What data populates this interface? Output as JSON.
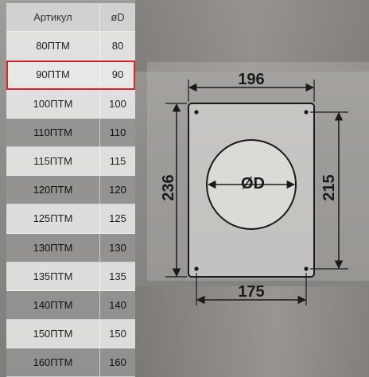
{
  "table": {
    "header": {
      "code": "Артикул",
      "dia": "øD"
    },
    "rows": [
      {
        "code": "80ПТМ",
        "dia": "80"
      },
      {
        "code": "90ПТМ",
        "dia": "90"
      },
      {
        "code": "100ПТМ",
        "dia": "100"
      },
      {
        "code": "110ПТМ",
        "dia": "110"
      },
      {
        "code": "115ПТМ",
        "dia": "115"
      },
      {
        "code": "120ПТМ",
        "dia": "120"
      },
      {
        "code": "125ПТМ",
        "dia": "125"
      },
      {
        "code": "130ПТМ",
        "dia": "130"
      },
      {
        "code": "135ПТМ",
        "dia": "135"
      },
      {
        "code": "140ПТМ",
        "dia": "140"
      },
      {
        "code": "150ПТМ",
        "dia": "150"
      },
      {
        "code": "160ПТМ",
        "dia": "160"
      }
    ],
    "selected_row": 1,
    "colors": {
      "selected_outline": "#d6252c"
    }
  },
  "drawing": {
    "width_top": "196",
    "width_bottom": "175",
    "height_left": "236",
    "height_right": "215",
    "hole_label": "ØD"
  }
}
